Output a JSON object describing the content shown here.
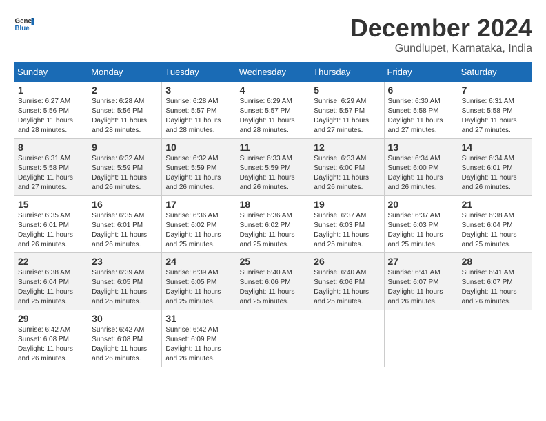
{
  "logo": {
    "text_general": "General",
    "text_blue": "Blue"
  },
  "title": {
    "month_year": "December 2024",
    "location": "Gundlupet, Karnataka, India"
  },
  "weekdays": [
    "Sunday",
    "Monday",
    "Tuesday",
    "Wednesday",
    "Thursday",
    "Friday",
    "Saturday"
  ],
  "weeks": [
    [
      {
        "day": "1",
        "sunrise": "Sunrise: 6:27 AM",
        "sunset": "Sunset: 5:56 PM",
        "daylight": "Daylight: 11 hours and 28 minutes."
      },
      {
        "day": "2",
        "sunrise": "Sunrise: 6:28 AM",
        "sunset": "Sunset: 5:56 PM",
        "daylight": "Daylight: 11 hours and 28 minutes."
      },
      {
        "day": "3",
        "sunrise": "Sunrise: 6:28 AM",
        "sunset": "Sunset: 5:57 PM",
        "daylight": "Daylight: 11 hours and 28 minutes."
      },
      {
        "day": "4",
        "sunrise": "Sunrise: 6:29 AM",
        "sunset": "Sunset: 5:57 PM",
        "daylight": "Daylight: 11 hours and 28 minutes."
      },
      {
        "day": "5",
        "sunrise": "Sunrise: 6:29 AM",
        "sunset": "Sunset: 5:57 PM",
        "daylight": "Daylight: 11 hours and 27 minutes."
      },
      {
        "day": "6",
        "sunrise": "Sunrise: 6:30 AM",
        "sunset": "Sunset: 5:58 PM",
        "daylight": "Daylight: 11 hours and 27 minutes."
      },
      {
        "day": "7",
        "sunrise": "Sunrise: 6:31 AM",
        "sunset": "Sunset: 5:58 PM",
        "daylight": "Daylight: 11 hours and 27 minutes."
      }
    ],
    [
      {
        "day": "8",
        "sunrise": "Sunrise: 6:31 AM",
        "sunset": "Sunset: 5:58 PM",
        "daylight": "Daylight: 11 hours and 27 minutes."
      },
      {
        "day": "9",
        "sunrise": "Sunrise: 6:32 AM",
        "sunset": "Sunset: 5:59 PM",
        "daylight": "Daylight: 11 hours and 26 minutes."
      },
      {
        "day": "10",
        "sunrise": "Sunrise: 6:32 AM",
        "sunset": "Sunset: 5:59 PM",
        "daylight": "Daylight: 11 hours and 26 minutes."
      },
      {
        "day": "11",
        "sunrise": "Sunrise: 6:33 AM",
        "sunset": "Sunset: 5:59 PM",
        "daylight": "Daylight: 11 hours and 26 minutes."
      },
      {
        "day": "12",
        "sunrise": "Sunrise: 6:33 AM",
        "sunset": "Sunset: 6:00 PM",
        "daylight": "Daylight: 11 hours and 26 minutes."
      },
      {
        "day": "13",
        "sunrise": "Sunrise: 6:34 AM",
        "sunset": "Sunset: 6:00 PM",
        "daylight": "Daylight: 11 hours and 26 minutes."
      },
      {
        "day": "14",
        "sunrise": "Sunrise: 6:34 AM",
        "sunset": "Sunset: 6:01 PM",
        "daylight": "Daylight: 11 hours and 26 minutes."
      }
    ],
    [
      {
        "day": "15",
        "sunrise": "Sunrise: 6:35 AM",
        "sunset": "Sunset: 6:01 PM",
        "daylight": "Daylight: 11 hours and 26 minutes."
      },
      {
        "day": "16",
        "sunrise": "Sunrise: 6:35 AM",
        "sunset": "Sunset: 6:01 PM",
        "daylight": "Daylight: 11 hours and 26 minutes."
      },
      {
        "day": "17",
        "sunrise": "Sunrise: 6:36 AM",
        "sunset": "Sunset: 6:02 PM",
        "daylight": "Daylight: 11 hours and 25 minutes."
      },
      {
        "day": "18",
        "sunrise": "Sunrise: 6:36 AM",
        "sunset": "Sunset: 6:02 PM",
        "daylight": "Daylight: 11 hours and 25 minutes."
      },
      {
        "day": "19",
        "sunrise": "Sunrise: 6:37 AM",
        "sunset": "Sunset: 6:03 PM",
        "daylight": "Daylight: 11 hours and 25 minutes."
      },
      {
        "day": "20",
        "sunrise": "Sunrise: 6:37 AM",
        "sunset": "Sunset: 6:03 PM",
        "daylight": "Daylight: 11 hours and 25 minutes."
      },
      {
        "day": "21",
        "sunrise": "Sunrise: 6:38 AM",
        "sunset": "Sunset: 6:04 PM",
        "daylight": "Daylight: 11 hours and 25 minutes."
      }
    ],
    [
      {
        "day": "22",
        "sunrise": "Sunrise: 6:38 AM",
        "sunset": "Sunset: 6:04 PM",
        "daylight": "Daylight: 11 hours and 25 minutes."
      },
      {
        "day": "23",
        "sunrise": "Sunrise: 6:39 AM",
        "sunset": "Sunset: 6:05 PM",
        "daylight": "Daylight: 11 hours and 25 minutes."
      },
      {
        "day": "24",
        "sunrise": "Sunrise: 6:39 AM",
        "sunset": "Sunset: 6:05 PM",
        "daylight": "Daylight: 11 hours and 25 minutes."
      },
      {
        "day": "25",
        "sunrise": "Sunrise: 6:40 AM",
        "sunset": "Sunset: 6:06 PM",
        "daylight": "Daylight: 11 hours and 25 minutes."
      },
      {
        "day": "26",
        "sunrise": "Sunrise: 6:40 AM",
        "sunset": "Sunset: 6:06 PM",
        "daylight": "Daylight: 11 hours and 25 minutes."
      },
      {
        "day": "27",
        "sunrise": "Sunrise: 6:41 AM",
        "sunset": "Sunset: 6:07 PM",
        "daylight": "Daylight: 11 hours and 26 minutes."
      },
      {
        "day": "28",
        "sunrise": "Sunrise: 6:41 AM",
        "sunset": "Sunset: 6:07 PM",
        "daylight": "Daylight: 11 hours and 26 minutes."
      }
    ],
    [
      {
        "day": "29",
        "sunrise": "Sunrise: 6:42 AM",
        "sunset": "Sunset: 6:08 PM",
        "daylight": "Daylight: 11 hours and 26 minutes."
      },
      {
        "day": "30",
        "sunrise": "Sunrise: 6:42 AM",
        "sunset": "Sunset: 6:08 PM",
        "daylight": "Daylight: 11 hours and 26 minutes."
      },
      {
        "day": "31",
        "sunrise": "Sunrise: 6:42 AM",
        "sunset": "Sunset: 6:09 PM",
        "daylight": "Daylight: 11 hours and 26 minutes."
      },
      null,
      null,
      null,
      null
    ]
  ]
}
